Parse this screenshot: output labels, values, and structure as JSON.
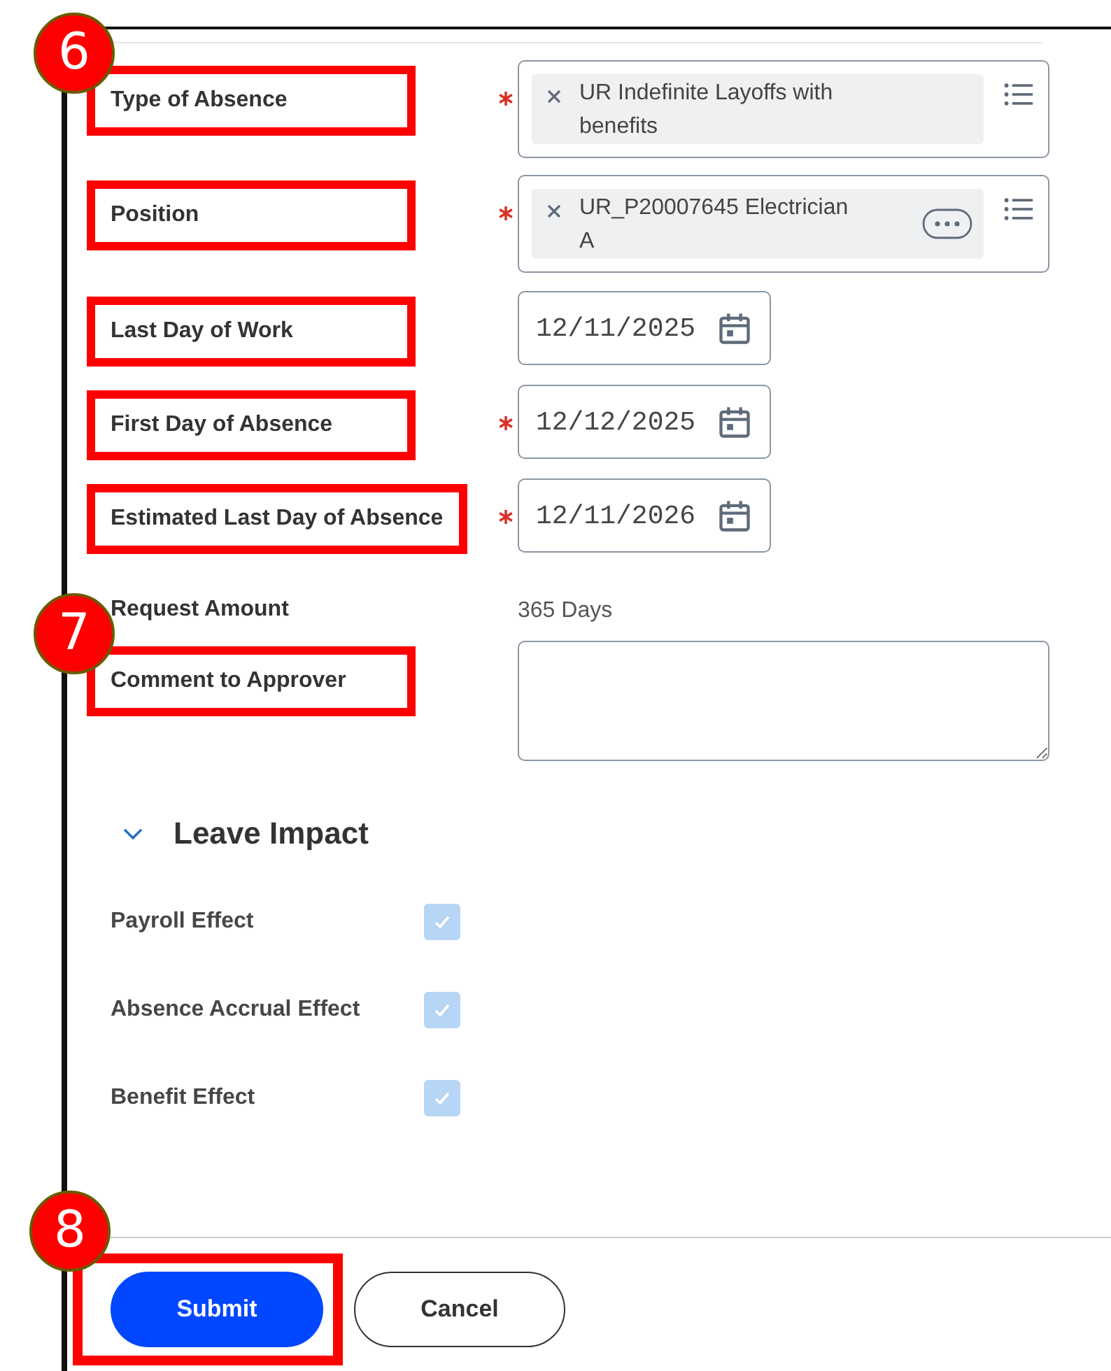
{
  "fields": [
    {
      "label": "Type of Absence",
      "required": true,
      "highlighted": true,
      "marker": "6",
      "kind": "chip",
      "value": "UR Indefinite Layoffs with benefits",
      "more_button": false
    },
    {
      "label": "Position",
      "required": true,
      "highlighted": true,
      "kind": "chip",
      "value": "UR_P20007645 Electrician A",
      "more_button": true
    },
    {
      "label": "Last Day of Work",
      "required": false,
      "highlighted": true,
      "kind": "date",
      "value": "12/11/2025"
    },
    {
      "label": "First Day of Absence",
      "required": true,
      "highlighted": true,
      "kind": "date",
      "value": "12/12/2025"
    },
    {
      "label": "Estimated Last Day of Absence",
      "required": true,
      "highlighted": true,
      "kind": "date",
      "value": "12/11/2026"
    },
    {
      "label": "Request Amount",
      "required": false,
      "highlighted": false,
      "kind": "readonly",
      "value": "365 Days"
    },
    {
      "label": "Comment to Approver",
      "required": false,
      "highlighted": true,
      "marker": "7",
      "kind": "textarea"
    }
  ],
  "leave_impact": {
    "title": "Leave Impact",
    "expanded": true,
    "items": [
      {
        "label": "Payroll Effect",
        "checked": true,
        "disabled": true
      },
      {
        "label": "Absence Accrual Effect",
        "checked": true,
        "disabled": true
      },
      {
        "label": "Benefit Effect",
        "checked": true,
        "disabled": true
      }
    ]
  },
  "buttons": [
    {
      "label": "Submit",
      "kind": "primary",
      "highlighted": true,
      "marker": "8"
    },
    {
      "label": "Cancel",
      "kind": "secondary",
      "highlighted": false
    }
  ]
}
